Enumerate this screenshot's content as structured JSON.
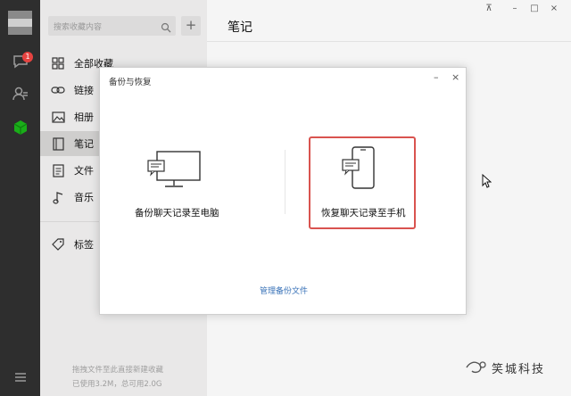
{
  "nav": {
    "unread_count": "1"
  },
  "sidebar": {
    "search_placeholder": "搜索收藏内容",
    "add_label": "+",
    "items": [
      {
        "label": "全部收藏",
        "icon": "grid-icon"
      },
      {
        "label": "链接",
        "icon": "link-icon"
      },
      {
        "label": "相册",
        "icon": "image-icon"
      },
      {
        "label": "笔记",
        "icon": "note-icon",
        "selected": true
      },
      {
        "label": "文件",
        "icon": "file-icon"
      },
      {
        "label": "音乐",
        "icon": "music-icon"
      },
      {
        "label": "标签",
        "icon": "tag-icon"
      }
    ],
    "footer_hint": "拖拽文件至此直接新建收藏",
    "footer_usage": "已使用3.2M，总可用2.0G"
  },
  "main": {
    "title": "笔记"
  },
  "window_controls": {
    "pin": "⊼",
    "minimize": "–",
    "maximize": "□",
    "close": "×"
  },
  "dialog": {
    "title": "备份与恢复",
    "minimize": "–",
    "close": "×",
    "backup_label": "备份聊天记录至电脑",
    "restore_label": "恢复聊天记录至手机",
    "manage_link": "管理备份文件"
  },
  "watermark": {
    "text": "笑城科技"
  },
  "colors": {
    "rail": "#2e2e2e",
    "panel": "#e9e8e8",
    "accent_green": "#1aad19",
    "highlight_red": "#d9534f",
    "link_blue": "#3a73b8"
  }
}
